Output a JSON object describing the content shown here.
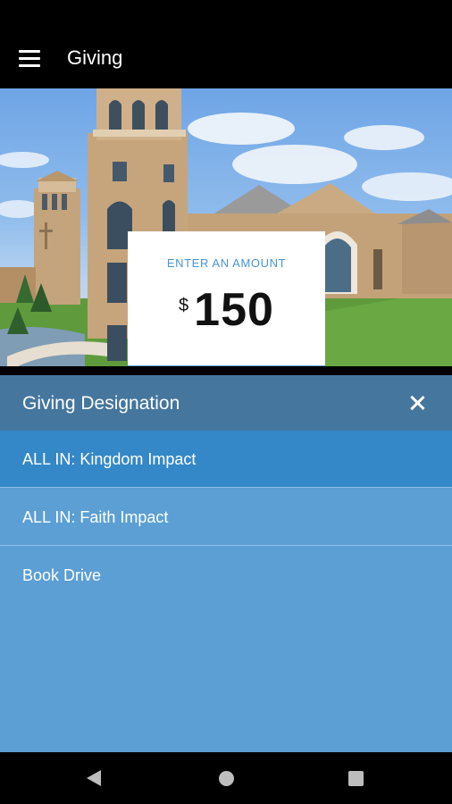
{
  "app": {
    "title": "Giving"
  },
  "amount": {
    "label": "ENTER AN AMOUNT",
    "currency": "$",
    "value": "150"
  },
  "designation": {
    "title": "Giving Designation",
    "options": [
      {
        "label": "ALL IN: Kingdom Impact",
        "selected": true
      },
      {
        "label": "ALL IN: Faith Impact",
        "selected": false
      },
      {
        "label": "Book Drive",
        "selected": false
      }
    ]
  },
  "icons": {
    "menu": "hamburger-menu-icon",
    "close": "close-icon",
    "back": "nav-back-icon",
    "home": "nav-home-icon",
    "recents": "nav-recents-icon"
  },
  "colors": {
    "panel_header": "#44769e",
    "selected_option": "#3488c7",
    "option": "#5b9fd4",
    "amount_accent": "#4a95cf"
  }
}
